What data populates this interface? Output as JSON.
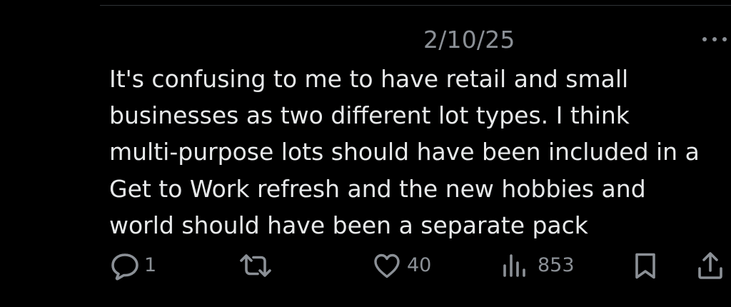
{
  "post": {
    "timestamp": "2/10/25",
    "text_lines": [
      "It's confusing to me to have retail and small",
      "businesses as two different lot types. I think",
      "multi-purpose lots should have been included in a",
      "Get to Work refresh and the new hobbies and",
      "world should have been a separate pack"
    ]
  },
  "actions": {
    "reply": {
      "icon": "reply-icon",
      "count": "1"
    },
    "repost": {
      "icon": "repost-icon",
      "count": ""
    },
    "like": {
      "icon": "heart-icon",
      "count": "40"
    },
    "views": {
      "icon": "views-icon",
      "count": "853"
    },
    "bookmark": {
      "icon": "bookmark-icon"
    },
    "share": {
      "icon": "share-icon"
    },
    "more": {
      "icon": "more-icon"
    }
  },
  "colors": {
    "background": "#000000",
    "text": "#e7e9ea",
    "muted": "#8b9096",
    "divider": "#2f3336"
  }
}
